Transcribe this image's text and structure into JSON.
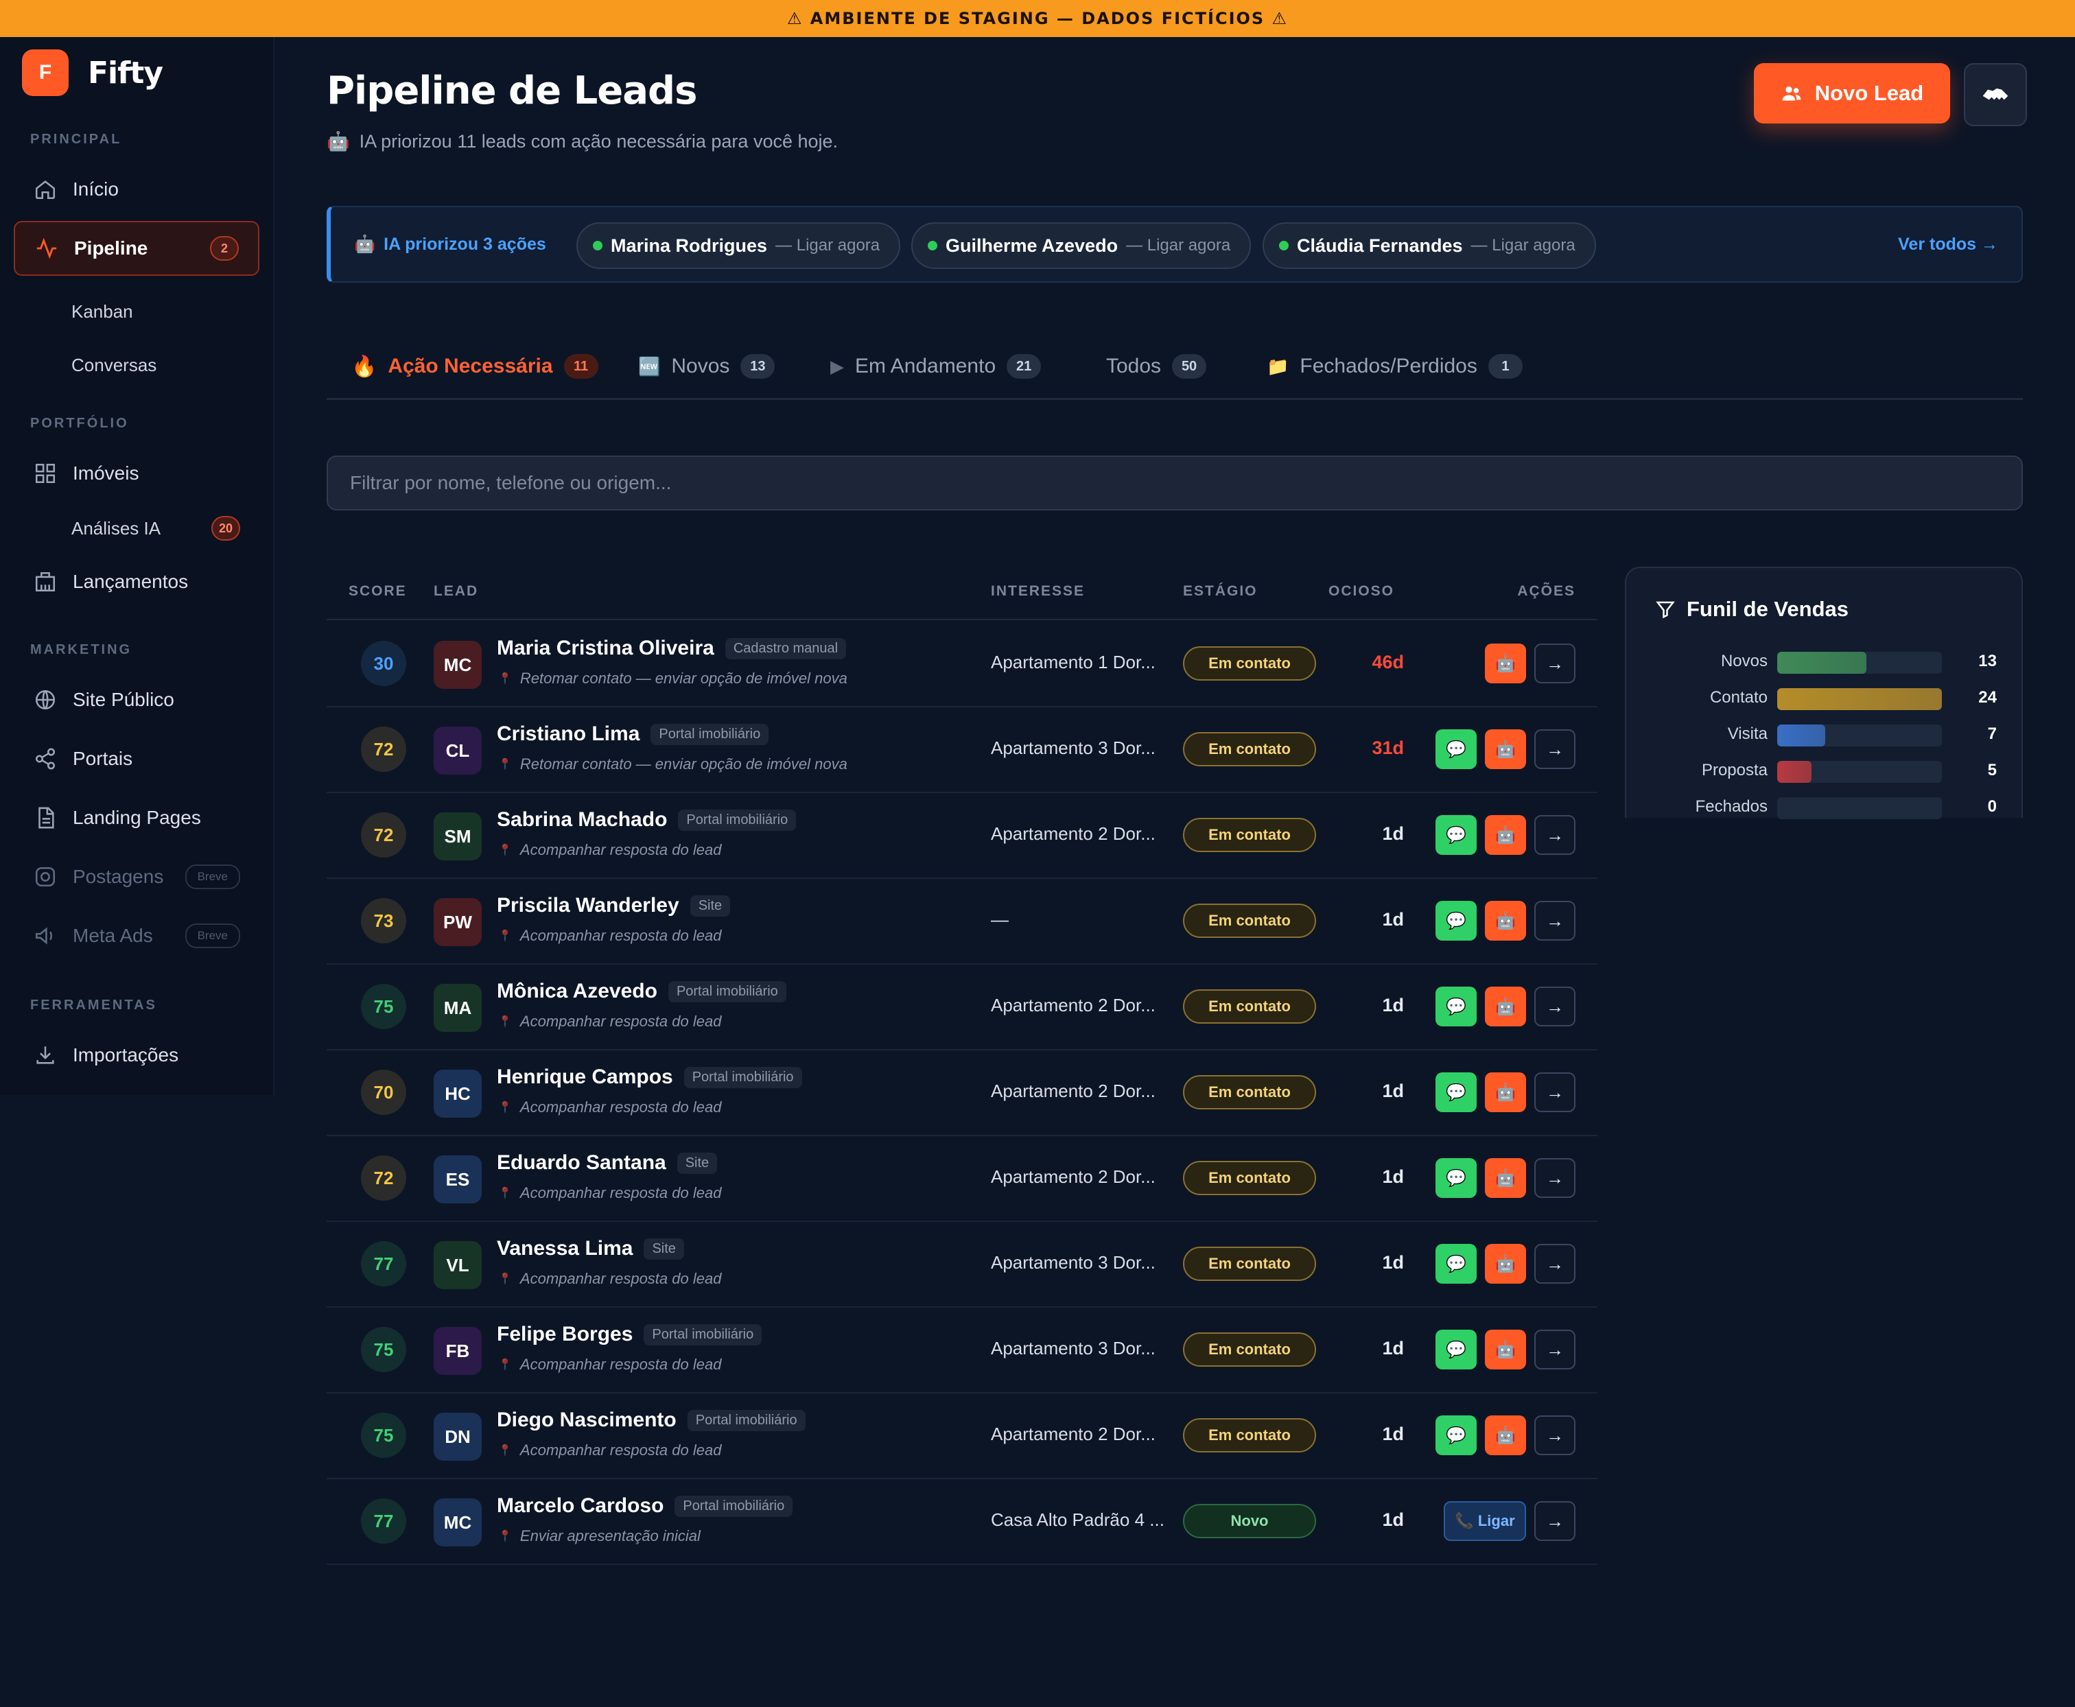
{
  "banner": "⚠ AMBIENTE DE STAGING — DADOS FICTÍCIOS ⚠",
  "brand": {
    "logo": "F",
    "name": "Fifty"
  },
  "sidebar": {
    "sections": {
      "principal": "PRINCIPAL",
      "portfolio": "PORTFÓLIO",
      "marketing": "MARKETING",
      "ferramentas": "FERRAMENTAS"
    },
    "items": {
      "inicio": "Início",
      "pipeline": "Pipeline",
      "pipeline_badge": "2",
      "kanban": "Kanban",
      "conversas": "Conversas",
      "imoveis": "Imóveis",
      "analises": "Análises IA",
      "analises_badge": "20",
      "lancamentos": "Lançamentos",
      "site": "Site Público",
      "portais": "Portais",
      "landing": "Landing Pages",
      "postagens": "Postagens",
      "postagens_pill": "Breve",
      "meta": "Meta Ads",
      "meta_pill": "Breve",
      "importacoes": "Importações"
    }
  },
  "header": {
    "title": "Pipeline de Leads",
    "subtitle_icon": "🤖",
    "subtitle": "IA priorizou 11 leads com ação necessária para você hoje.",
    "new_lead": "Novo Lead"
  },
  "ai_bar": {
    "icon": "🤖",
    "title": "IA priorizou 3 ações",
    "chips": [
      {
        "name": "Marina Rodrigues",
        "action": "— Ligar agora"
      },
      {
        "name": "Guilherme Azevedo",
        "action": "— Ligar agora"
      },
      {
        "name": "Cláudia Fernandes",
        "action": "— Ligar agora"
      }
    ],
    "see_all": "Ver todos →"
  },
  "tabs": [
    {
      "icon": "🔥",
      "label": "Ação Necessária",
      "count": "11"
    },
    {
      "icon": "🆕",
      "label": "Novos",
      "count": "13"
    },
    {
      "icon": "▶",
      "label": "Em Andamento",
      "count": "21"
    },
    {
      "icon": "",
      "label": "Todos",
      "count": "50"
    },
    {
      "icon": "📁",
      "label": "Fechados/Perdidos",
      "count": "1"
    }
  ],
  "search": {
    "placeholder": "Filtrar por nome, telefone ou origem..."
  },
  "table": {
    "headers": {
      "score": "SCORE",
      "lead": "LEAD",
      "interesse": "INTERESSE",
      "estagio": "ESTÁGIO",
      "ocioso": "OCIOSO",
      "acoes": "AÇÕES"
    },
    "rows": [
      {
        "score": "30",
        "score_color": "#4ca2ff",
        "initials": "MC",
        "avatar_color": "#4a1d22",
        "name": "Maria Cristina Oliveira",
        "source": "Cadastro manual",
        "note": "Retomar contato — enviar opção de imóvel nova",
        "interest": "Apartamento 1 Dor...",
        "stage": "Em contato",
        "idle": "46d",
        "late": true,
        "actions": "ai"
      },
      {
        "score": "72",
        "score_color": "#f5c542",
        "initials": "CL",
        "avatar_color": "#2c1a4a",
        "name": "Cristiano Lima",
        "source": "Portal imobiliário",
        "note": "Retomar contato — enviar opção de imóvel nova",
        "interest": "Apartamento 3 Dor...",
        "stage": "Em contato",
        "idle": "31d",
        "late": true,
        "actions": "wa-ai"
      },
      {
        "score": "72",
        "score_color": "#f5c542",
        "initials": "SM",
        "avatar_color": "#173526",
        "name": "Sabrina Machado",
        "source": "Portal imobiliário",
        "note": "Acompanhar resposta do lead",
        "interest": "Apartamento 2 Dor...",
        "stage": "Em contato",
        "idle": "1d",
        "late": false,
        "actions": "wa-ai"
      },
      {
        "score": "73",
        "score_color": "#f5c542",
        "initials": "PW",
        "avatar_color": "#4a1d22",
        "name": "Priscila Wanderley",
        "source": "Site",
        "note": "Acompanhar resposta do lead",
        "interest": "—",
        "stage": "Em contato",
        "idle": "1d",
        "late": false,
        "actions": "wa-ai"
      },
      {
        "score": "75",
        "score_color": "#3fd074",
        "initials": "MA",
        "avatar_color": "#173526",
        "name": "Mônica Azevedo",
        "source": "Portal imobiliário",
        "note": "Acompanhar resposta do lead",
        "interest": "Apartamento 2 Dor...",
        "stage": "Em contato",
        "idle": "1d",
        "late": false,
        "actions": "wa-ai"
      },
      {
        "score": "70",
        "score_color": "#f5c542",
        "initials": "HC",
        "avatar_color": "#1a3258",
        "name": "Henrique Campos",
        "source": "Portal imobiliário",
        "note": "Acompanhar resposta do lead",
        "interest": "Apartamento 2 Dor...",
        "stage": "Em contato",
        "idle": "1d",
        "late": false,
        "actions": "wa-ai"
      },
      {
        "score": "72",
        "score_color": "#f5c542",
        "initials": "ES",
        "avatar_color": "#1a3258",
        "name": "Eduardo Santana",
        "source": "Site",
        "note": "Acompanhar resposta do lead",
        "interest": "Apartamento 2 Dor...",
        "stage": "Em contato",
        "idle": "1d",
        "late": false,
        "actions": "wa-ai"
      },
      {
        "score": "77",
        "score_color": "#3fd074",
        "initials": "VL",
        "avatar_color": "#173526",
        "name": "Vanessa Lima",
        "source": "Site",
        "note": "Acompanhar resposta do lead",
        "interest": "Apartamento 3 Dor...",
        "stage": "Em contato",
        "idle": "1d",
        "late": false,
        "actions": "wa-ai"
      },
      {
        "score": "75",
        "score_color": "#3fd074",
        "initials": "FB",
        "avatar_color": "#2c1a4a",
        "name": "Felipe Borges",
        "source": "Portal imobiliário",
        "note": "Acompanhar resposta do lead",
        "interest": "Apartamento 3 Dor...",
        "stage": "Em contato",
        "idle": "1d",
        "late": false,
        "actions": "wa-ai"
      },
      {
        "score": "75",
        "score_color": "#3fd074",
        "initials": "DN",
        "avatar_color": "#1a3258",
        "name": "Diego Nascimento",
        "source": "Portal imobiliário",
        "note": "Acompanhar resposta do lead",
        "interest": "Apartamento 2 Dor...",
        "stage": "Em contato",
        "idle": "1d",
        "late": false,
        "actions": "wa-ai"
      },
      {
        "score": "77",
        "score_color": "#3fd074",
        "initials": "MC",
        "avatar_color": "#1a3258",
        "name": "Marcelo Cardoso",
        "source": "Portal imobiliário",
        "note": "Enviar apresentação inicial",
        "interest": "Casa Alto Padrão 4 ...",
        "stage": "Novo",
        "idle": "1d",
        "late": false,
        "actions": "call",
        "call_label": "📞 Ligar"
      }
    ],
    "go_label": "→",
    "wa_icon": "💬",
    "ai_icon": "🤖",
    "note_icon": "📍"
  },
  "funnel": {
    "title": "Funil de Vendas",
    "max": 24,
    "stages": [
      {
        "label": "Novos",
        "value": 13,
        "color": "#3f8a57"
      },
      {
        "label": "Contato",
        "value": 24,
        "color": "#b58c2a"
      },
      {
        "label": "Visita",
        "value": 7,
        "color": "#3a6fc4"
      },
      {
        "label": "Proposta",
        "value": 5,
        "color": "#b83a40"
      },
      {
        "label": "Fechados",
        "value": 0,
        "color": "#3f8a57"
      }
    ]
  }
}
